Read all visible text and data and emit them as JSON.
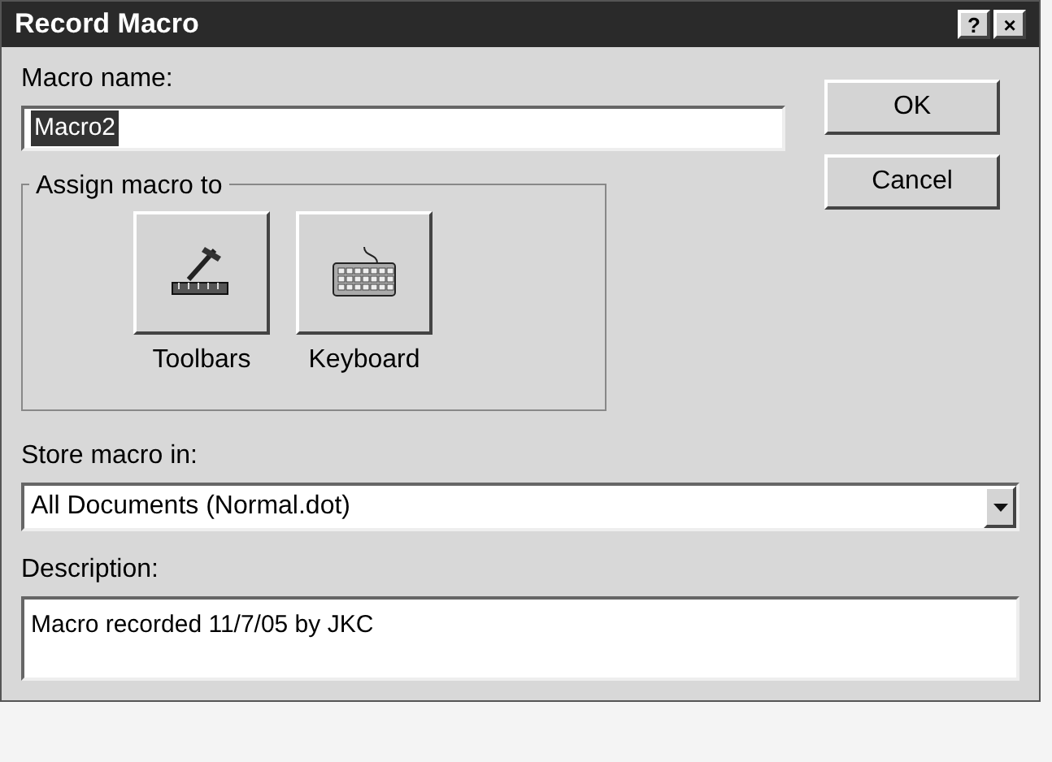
{
  "window": {
    "title": "Record Macro",
    "title_buttons": [
      "?",
      "×"
    ]
  },
  "macro_name": {
    "label": "Macro name:",
    "value": "Macro2",
    "selected": true
  },
  "buttons": [
    "OK",
    "Cancel"
  ],
  "assign": {
    "title": "Assign macro to",
    "items": [
      {
        "kind": "toolbar",
        "label": "Toolbars"
      },
      {
        "kind": "keyboard",
        "label": "Keyboard"
      }
    ]
  },
  "store": {
    "label": "Store macro in:",
    "value": "All Documents (Normal.dot)"
  },
  "description": {
    "label": "Description:",
    "value": "Macro recorded 11/7/05 by JKC"
  }
}
